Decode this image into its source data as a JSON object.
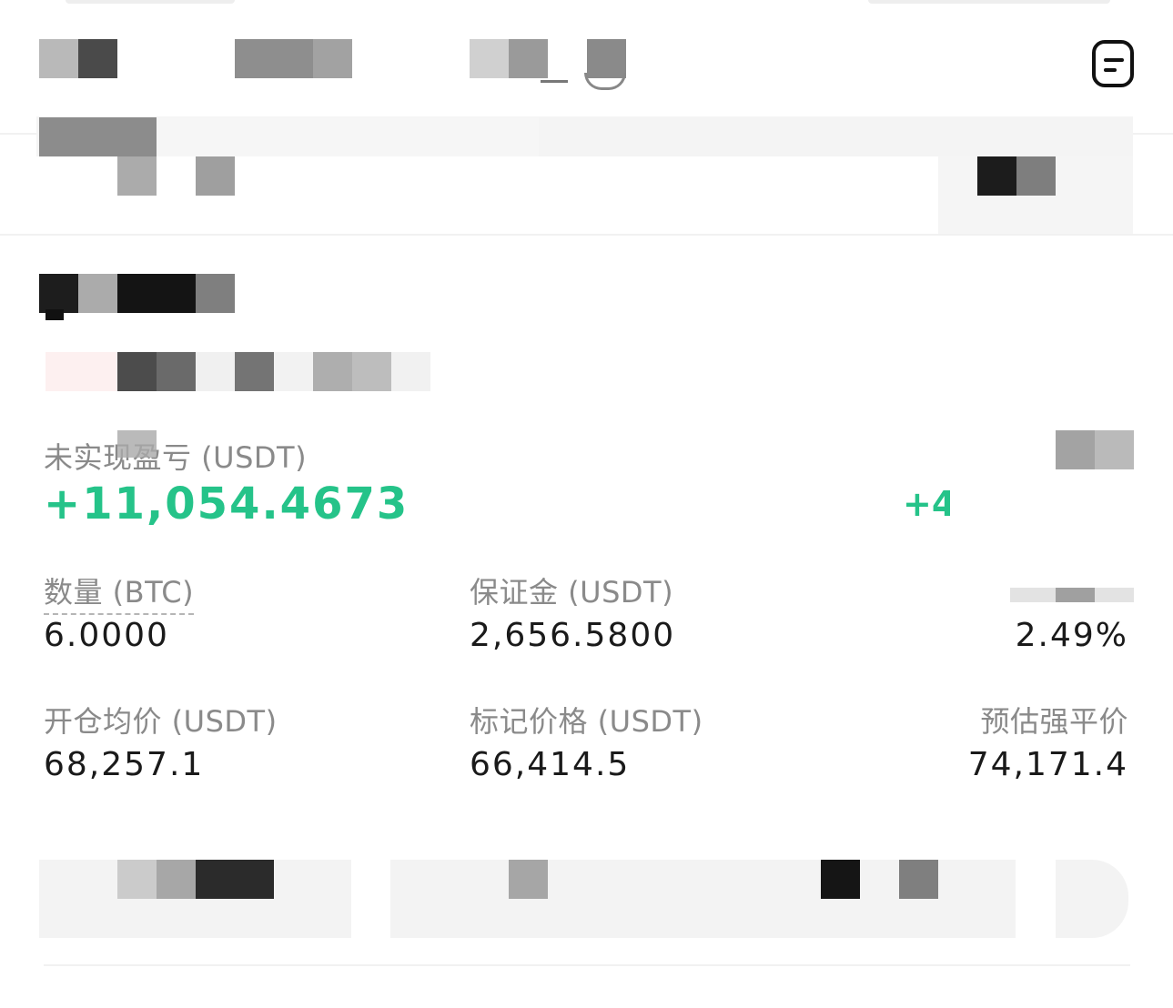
{
  "position": {
    "unrealized_pnl_label": "未实现盈亏 (USDT)",
    "unrealized_pnl_value": "+11,054.4673",
    "pnl_ratio_partial": "+4",
    "quantity_label": "数量 (BTC)",
    "quantity_value": "6.0000",
    "margin_label": "保证金 (USDT)",
    "margin_value": "2,656.5800",
    "margin_ratio_value": "2.49%",
    "entry_price_label": "开仓均价 (USDT)",
    "entry_price_value": "68,257.1",
    "mark_price_label": "标记价格 (USDT)",
    "mark_price_value": "66,414.5",
    "liq_price_label": "预估强平价",
    "liq_price_value": "74,171.4"
  },
  "header": {
    "icon": "document-icon"
  },
  "colors": {
    "profit": "#25c389",
    "label": "#8a8a8a",
    "value": "#1a1a1a"
  }
}
